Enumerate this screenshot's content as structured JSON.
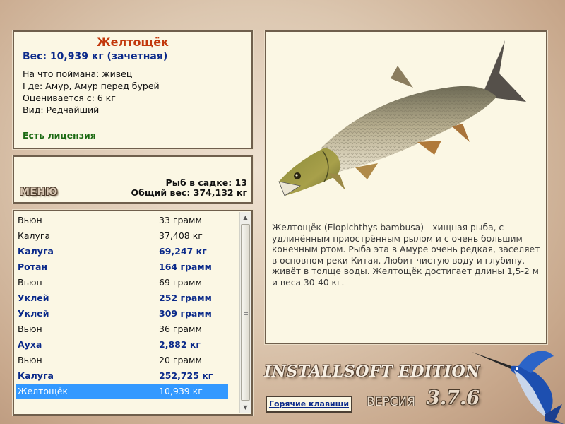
{
  "fish_card": {
    "title": "Желтощёк",
    "weight": "Вес: 10,939 кг (зачетная)",
    "bait": "На что поймана: живец",
    "location": "Где: Амур, Амур перед бурей",
    "valued_from": "Оценивается с: 6 кг",
    "kind": "Вид: Редчайший",
    "license": "Есть лицензия"
  },
  "menu": {
    "menu_label": "МЕНЮ",
    "fish_in_keepnet": "Рыб в садке: 13",
    "total_weight": "Общий вес: 374,132 кг"
  },
  "catch_list": [
    {
      "name": "Вьюн",
      "weight": "33 грамм",
      "bold": false,
      "selected": false
    },
    {
      "name": "Калуга",
      "weight": "37,408 кг",
      "bold": false,
      "selected": false
    },
    {
      "name": "Калуга",
      "weight": "69,247 кг",
      "bold": true,
      "selected": false
    },
    {
      "name": "Ротан",
      "weight": "164 грамм",
      "bold": true,
      "selected": false
    },
    {
      "name": "Вьюн",
      "weight": "69 грамм",
      "bold": false,
      "selected": false
    },
    {
      "name": "Уклей",
      "weight": "252 грамм",
      "bold": true,
      "selected": false
    },
    {
      "name": "Уклей",
      "weight": "309 грамм",
      "bold": true,
      "selected": false
    },
    {
      "name": "Вьюн",
      "weight": "36 грамм",
      "bold": false,
      "selected": false
    },
    {
      "name": "Ауха",
      "weight": "2,882 кг",
      "bold": true,
      "selected": false
    },
    {
      "name": "Вьюн",
      "weight": "20 грамм",
      "bold": false,
      "selected": false
    },
    {
      "name": "Калуга",
      "weight": "252,725 кг",
      "bold": true,
      "selected": false
    },
    {
      "name": "Желтощёк",
      "weight": "10,939 кг",
      "bold": false,
      "selected": true
    }
  ],
  "info": {
    "description": "Желтощёк (Elopichthys bambusa) - хищная рыба, с удлинённым приострённым рылом и с очень большим конечным ртом. Рыба эта в Амуре очень редкая, заселяет в основном реки Китая. Любит чистую воду и глубину, живёт в толще воды. Желтощёк достигает длины 1,5-2 м и веса 30-40 кг."
  },
  "branding": {
    "edition": "INSTALLSOFT EDITION",
    "version_label": "ВЕРСИЯ",
    "version_number": "3.7.6"
  },
  "hotkeys_label": "Горячие клавиши",
  "colors": {
    "panel_bg": "#fbf7e4",
    "title": "#c2380c",
    "accent_blue": "#0b2a8a",
    "license_green": "#1b6a12",
    "selection": "#3399ff"
  },
  "icons": {
    "fish_picture": "yellowcheek-fish-illustration",
    "marlin_logo": "marlin-icon",
    "scroll_up": "chevron-up-icon",
    "scroll_down": "chevron-down-icon"
  }
}
